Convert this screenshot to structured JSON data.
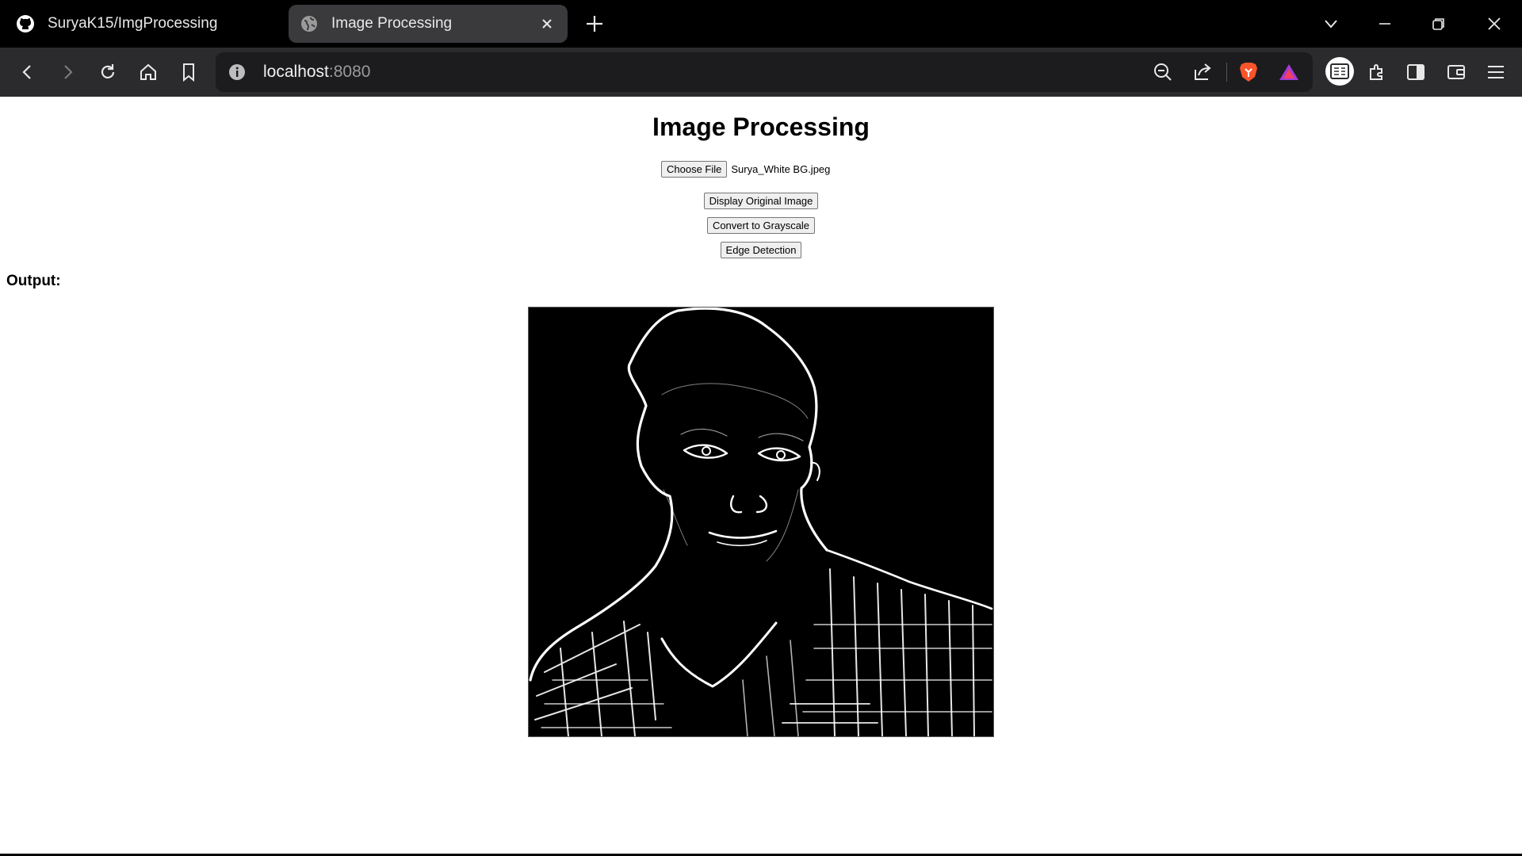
{
  "tabs": [
    {
      "title": "SuryaK15/ImgProcessing",
      "icon": "github-icon"
    },
    {
      "title": "Image Processing",
      "icon": "globe-icon"
    }
  ],
  "address_bar": {
    "host": "localhost",
    "port": ":8080"
  },
  "page": {
    "title": "Image Processing",
    "choose_file_label": "Choose File",
    "file_name": "Surya_White BG.jpeg",
    "buttons": {
      "display_original": "Display Original Image",
      "grayscale": "Convert to Grayscale",
      "edge_detection": "Edge Detection"
    },
    "output_label": "Output:"
  },
  "colors": {
    "tab_bar": "#000000",
    "toolbar": "#2b2b2e",
    "active_tab": "#3a3a3d",
    "brave_orange": "#fb542b"
  }
}
